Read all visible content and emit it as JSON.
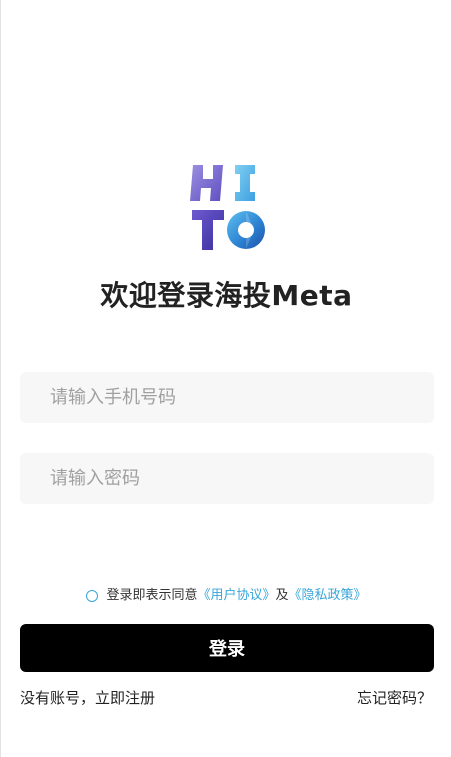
{
  "welcome": {
    "title": "欢迎登录海投Meta"
  },
  "form": {
    "phone_placeholder": "请输入手机号码",
    "password_placeholder": "请输入密码"
  },
  "agreement": {
    "prefix": "登录即表示同意",
    "user_agreement": "《用户协议》",
    "conjunction": "及",
    "privacy_policy": "《隐私政策》"
  },
  "actions": {
    "login_label": "登录",
    "register_label": "没有账号，立即注册",
    "forgot_label": "忘记密码？"
  },
  "colors": {
    "accent": "#38a6d8",
    "button": "#000000",
    "input_bg": "#f7f7f7"
  }
}
